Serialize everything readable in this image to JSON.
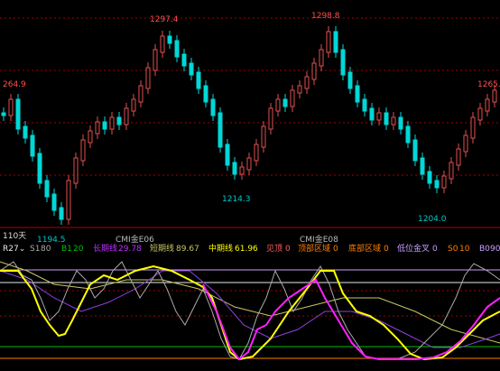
{
  "colors": {
    "up": "#e05050",
    "down": "#00d7d7",
    "price_label": "#ff5050",
    "low_label": "#00c8c8",
    "white": "#e8e8e8",
    "yellow": "#ffff00",
    "magenta": "#ff20ff",
    "purple": "#9040e0",
    "olive": "#c8c864",
    "gray": "#aaaaaa",
    "green": "#00c000",
    "orange": "#ff8000",
    "lavender": "#c8a0ff",
    "grid_red": "#a00000"
  },
  "main_chart": {
    "type": "candlestick",
    "price_labels": {
      "high_left": "264.9",
      "high_1": "1297.4",
      "high_2": "1298.8",
      "high_right": "1265.0",
      "low_1": "1194.5",
      "low_2": "1214.3",
      "low_3": "1204.0"
    },
    "cross_labels": {
      "c1": "CMI金E06",
      "c2": "CMI金E08"
    },
    "price_range": [
      1190,
      1300
    ]
  },
  "period_label": "110天",
  "indicator_bar": {
    "name": "R27",
    "dropdown_icon": "chevron-down-icon",
    "s1_label": "S1",
    "s1_value": "80",
    "b1_label": "B1",
    "b1_value": "20",
    "long_label": "长期线",
    "long_value": "29.78",
    "short_label": "短期线",
    "short_value": "89.67",
    "mid_label": "中期线",
    "mid_value": "61.96",
    "jiandi_label": "见顶",
    "jiandi_value": "0",
    "top_zone_label": "顶部区域",
    "top_zone_value": "0",
    "bottom_zone_label": "底部区域",
    "bottom_zone_value": "0",
    "lowgold_label": "低位金叉",
    "lowgold_value": "0",
    "s0_label": "S0",
    "s0_value": "10",
    "b0_label": "B0",
    "b0_value": "90"
  }
}
